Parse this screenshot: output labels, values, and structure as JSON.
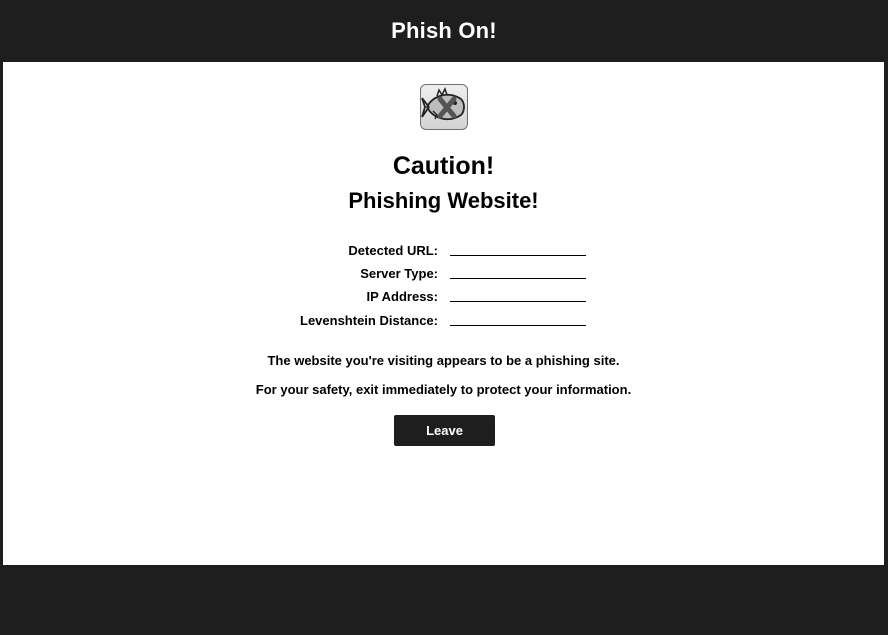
{
  "app": {
    "title": "Phish On!"
  },
  "icons": {
    "logo": "phishing-fish-x-icon"
  },
  "warning": {
    "heading": "Caution!",
    "subheading": "Phishing Website!"
  },
  "details": [
    {
      "label": "Detected URL:",
      "value": ""
    },
    {
      "label": "Server Type:",
      "value": ""
    },
    {
      "label": "IP Address:",
      "value": ""
    },
    {
      "label": "Levenshtein Distance:",
      "value": ""
    }
  ],
  "messages": {
    "line1": "The website you're visiting appears to be a phishing site.",
    "line2": "For your safety, exit immediately to protect your information."
  },
  "actions": {
    "leave_label": "Leave"
  },
  "colors": {
    "background": "#1e1e1e",
    "panel": "#ffffff",
    "button": "#1e1e1e"
  }
}
